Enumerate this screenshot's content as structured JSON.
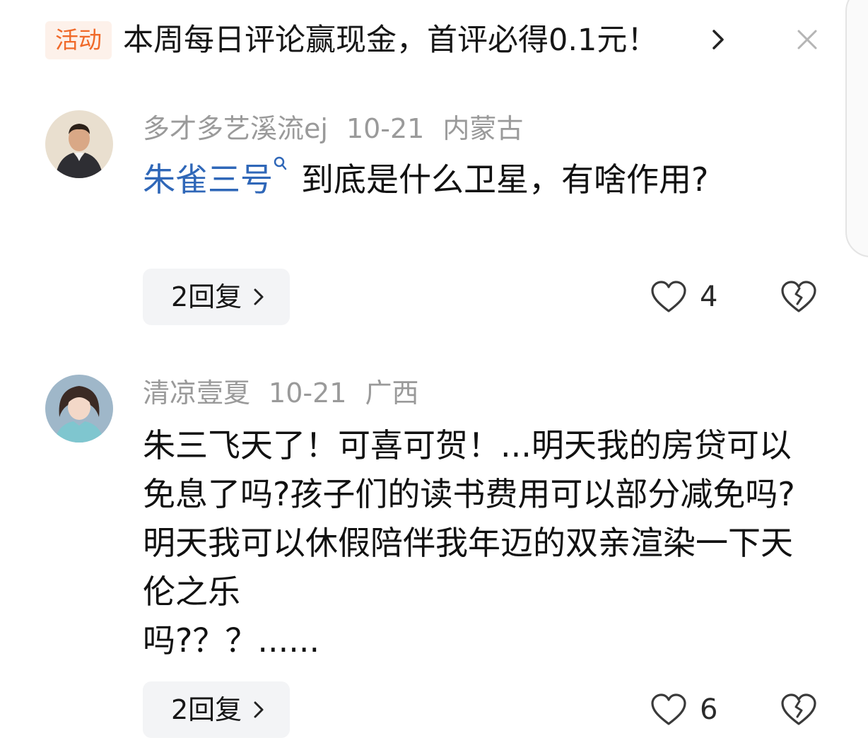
{
  "banner": {
    "tag": "活动",
    "text": "本周每日评论赢现金，首评必得0.1元！",
    "icons": [
      "chevron-right-icon",
      "close-icon"
    ]
  },
  "comments": [
    {
      "username": "多才多艺溪流ej",
      "date": "10-21",
      "location": "内蒙古",
      "mention": "朱雀三号",
      "text": "到底是什么卫星，有啥作用?",
      "reply_label": "2回复",
      "likes": "4",
      "avatar_icon": "user-avatar-man"
    },
    {
      "username": "清凉壹夏",
      "date": "10-21",
      "location": "广西",
      "text": "朱三飞天了！可喜可贺！...明天我的房贷可以免息了吗?孩子们的读书费用可以部分减免吗?明天我可以休假陪伴我年迈的双亲渲染一下天伦之乐",
      "text_tail": "吗?？？......",
      "reply_label": "2回复",
      "likes": "6",
      "avatar_icon": "user-avatar-woman"
    }
  ],
  "colors": {
    "tag_bg": "#fdf1ea",
    "tag_text": "#f06a2a",
    "mention": "#2f67b8",
    "meta": "#9a9a9a",
    "reply_bg": "#f3f4f6"
  }
}
